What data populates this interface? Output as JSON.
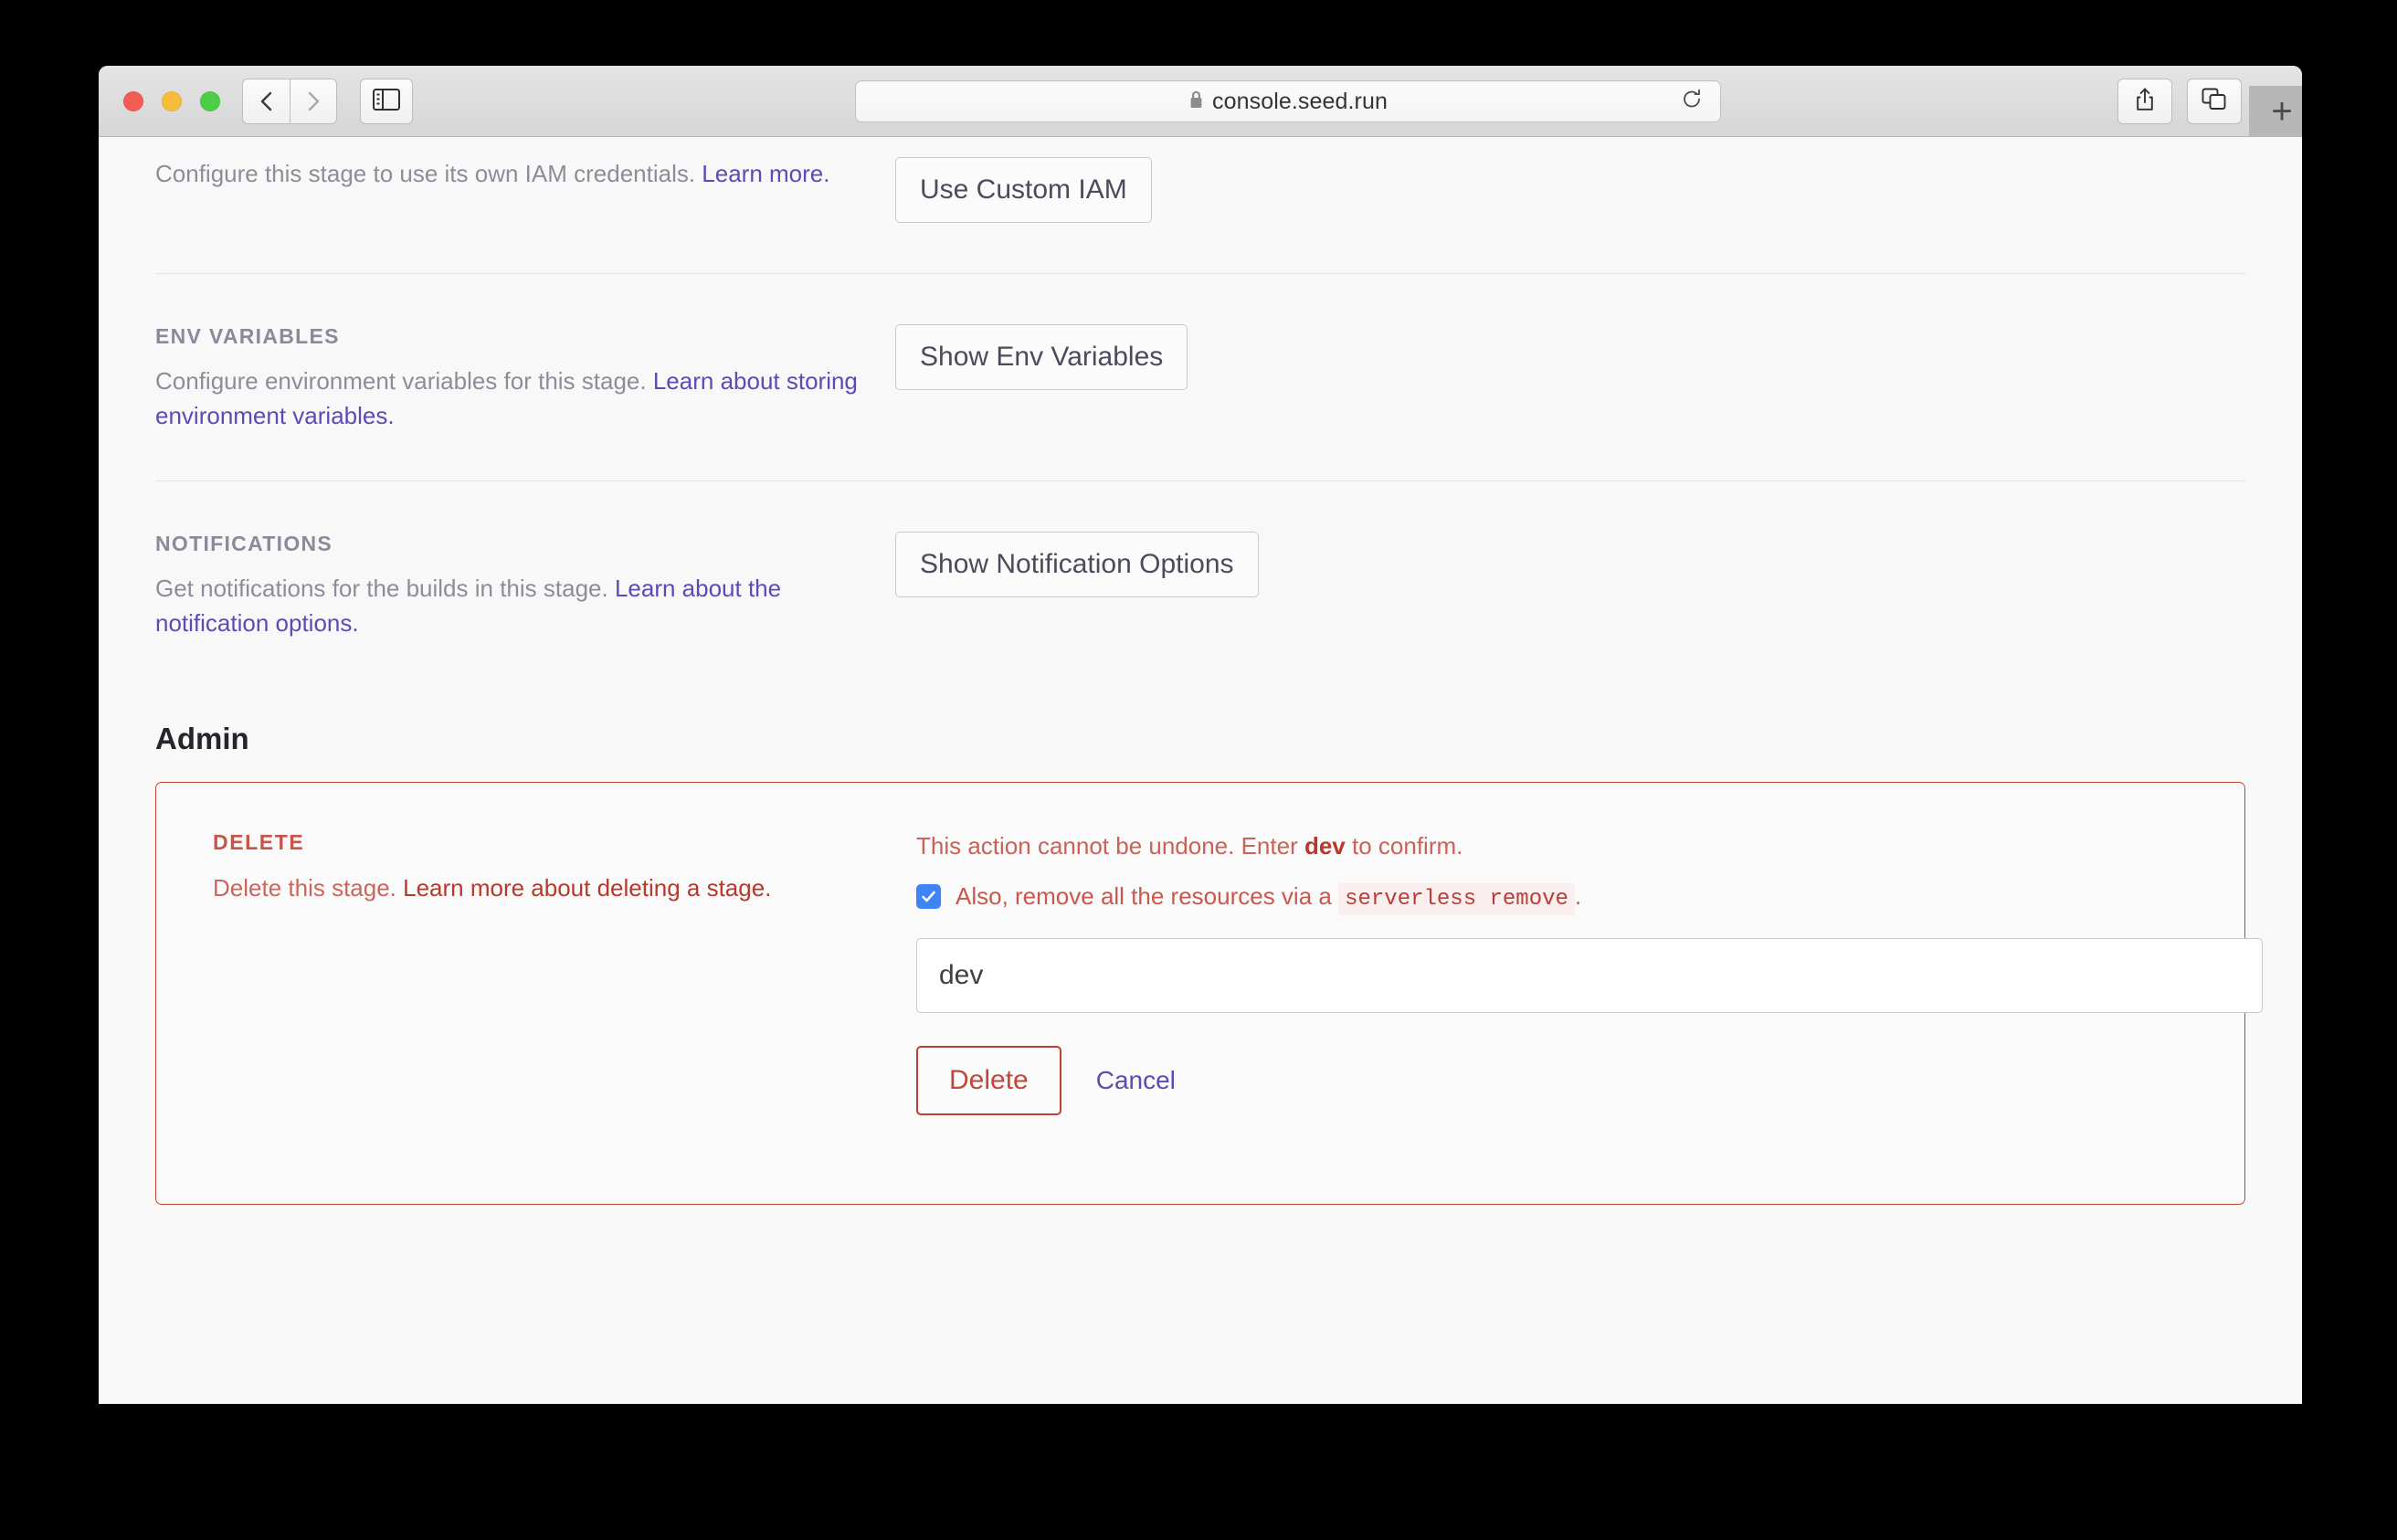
{
  "browser": {
    "url": "console.seed.run",
    "lock_icon": "lock-icon",
    "back_icon": "chevron-left-icon",
    "forward_icon": "chevron-right-icon",
    "sidebar_icon": "sidebar-toggle-icon",
    "reload_icon": "reload-icon",
    "share_icon": "share-icon",
    "tabs_icon": "tab-overview-icon",
    "new_tab_label": "+"
  },
  "sections": {
    "iam": {
      "desc_before": "Configure this stage to use its own IAM credentials. ",
      "link": "Learn more.",
      "button": "Use Custom IAM"
    },
    "env": {
      "label": "ENV VARIABLES",
      "desc_before": "Configure environment variables for this stage. ",
      "link": "Learn about storing environment variables.",
      "button": "Show Env Variables"
    },
    "notifications": {
      "label": "NOTIFICATIONS",
      "desc_before": "Get notifications for the builds in this stage. ",
      "link": "Learn about the notification options.",
      "button": "Show Notification Options"
    }
  },
  "admin": {
    "title": "Admin",
    "delete": {
      "label": "DELETE",
      "desc_before": "Delete this stage. ",
      "desc_link": "Learn more about deleting a stage.",
      "confirm_before": "This action cannot be undone. Enter ",
      "confirm_strong": "dev",
      "confirm_after": " to confirm.",
      "checkbox_checked": true,
      "checkbox_before": "Also, remove all the resources via a ",
      "checkbox_code": "serverless remove",
      "checkbox_after": ".",
      "input_value": "dev",
      "input_placeholder": "dev",
      "delete_button": "Delete",
      "cancel_link": "Cancel"
    }
  },
  "colors": {
    "danger": "#c44236",
    "link": "#5c4bb7",
    "checkbox": "#3f84f3",
    "muted": "#8d8d99"
  }
}
